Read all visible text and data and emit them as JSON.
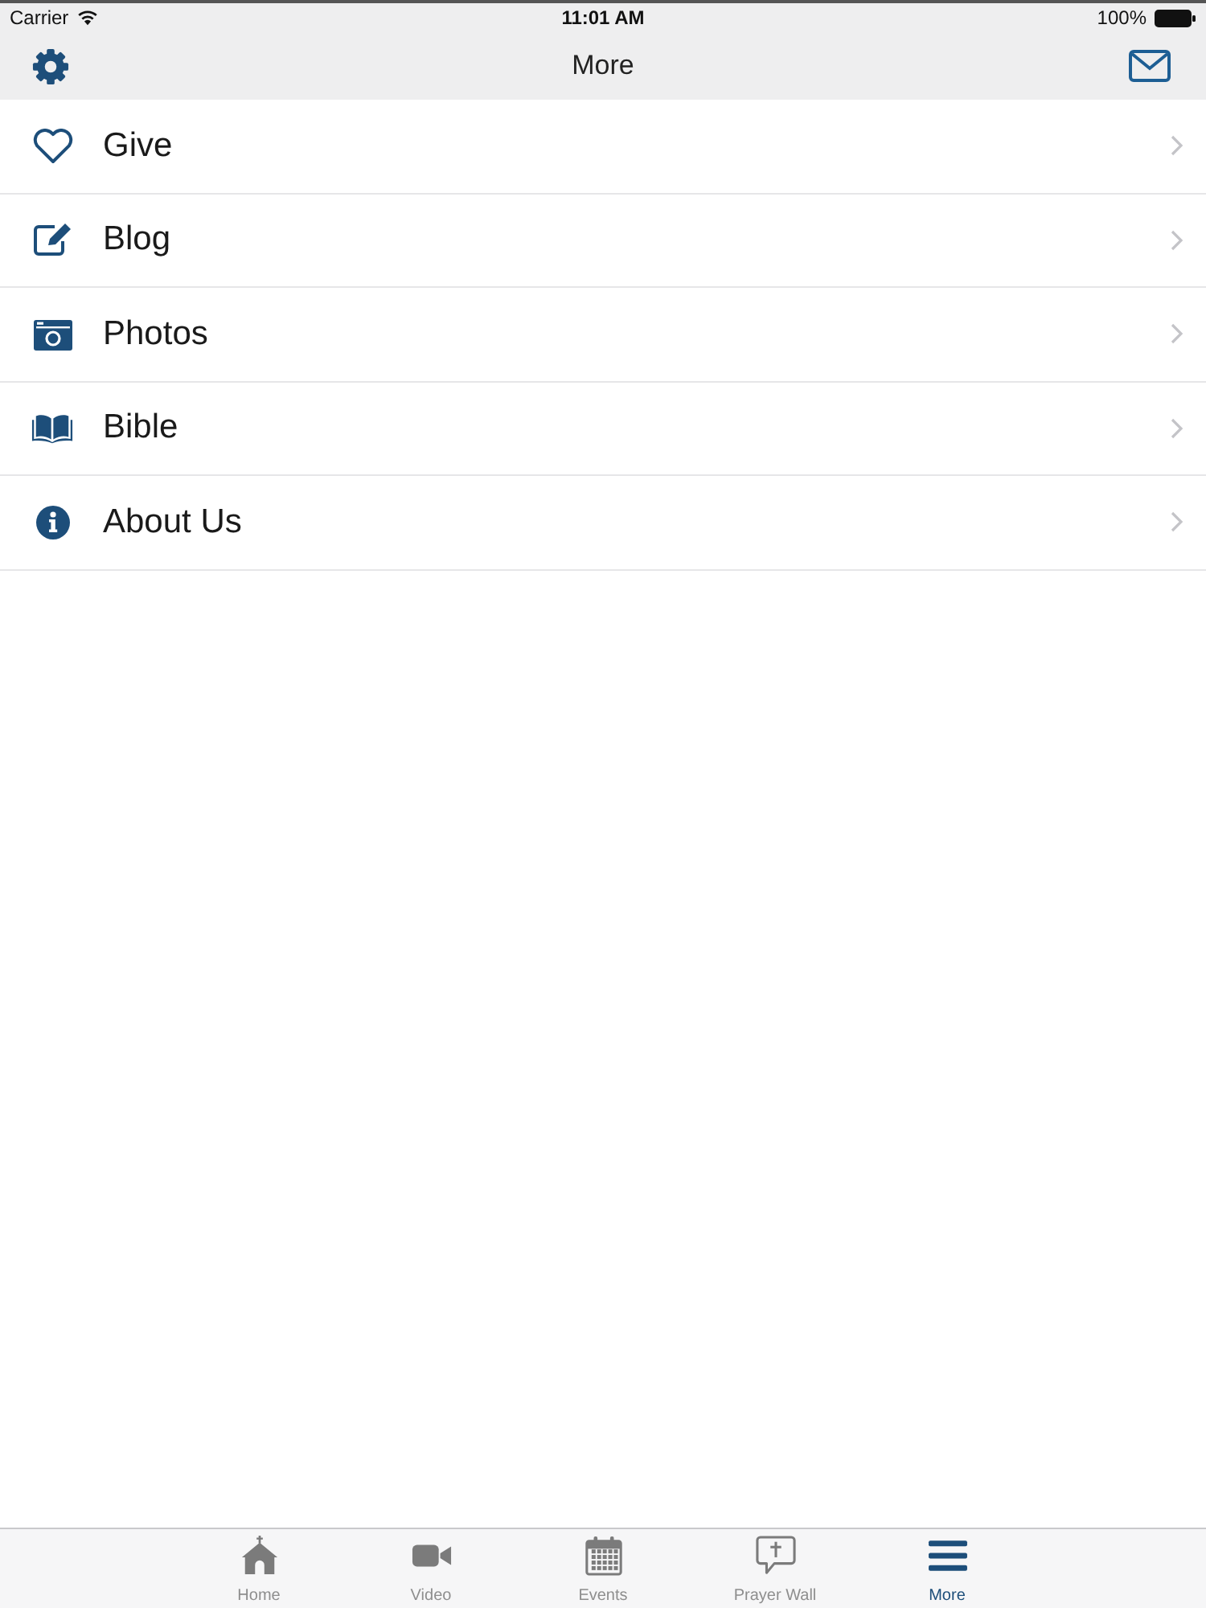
{
  "status_bar": {
    "carrier": "Carrier",
    "time": "11:01 AM",
    "battery": "100%"
  },
  "nav_bar": {
    "title": "More"
  },
  "menu": [
    {
      "kind": "heart",
      "label": "Give"
    },
    {
      "kind": "edit",
      "label": "Blog"
    },
    {
      "kind": "camera",
      "label": "Photos"
    },
    {
      "kind": "book",
      "label": "Bible"
    },
    {
      "kind": "info",
      "label": "About Us"
    }
  ],
  "tab_bar": [
    {
      "kind": "home",
      "label": "Home",
      "selected": false
    },
    {
      "kind": "video",
      "label": "Video",
      "selected": false
    },
    {
      "kind": "calendar",
      "label": "Events",
      "selected": false
    },
    {
      "kind": "prayer",
      "label": "Prayer Wall",
      "selected": false
    },
    {
      "kind": "menu",
      "label": "More",
      "selected": true
    }
  ]
}
